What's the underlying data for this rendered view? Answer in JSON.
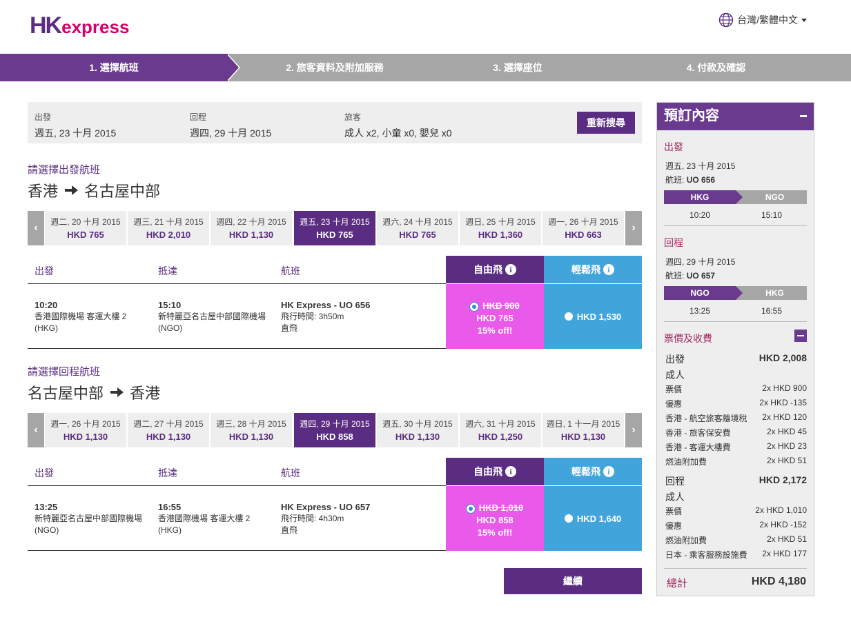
{
  "header": {
    "logo_hk": "HK",
    "logo_express": "express",
    "language": "台灣/繁體中文"
  },
  "steps": [
    {
      "label": "1. 選擇航班",
      "active": true
    },
    {
      "label": "2. 旅客資料及附加服務",
      "active": false
    },
    {
      "label": "3. 選擇座位",
      "active": false
    },
    {
      "label": "4. 付款及確認",
      "active": false
    }
  ],
  "summary": {
    "depart_label": "出發",
    "depart_value": "週五, 23 十月 2015",
    "return_label": "回程",
    "return_value": "週四, 29 十月 2015",
    "pax_label": "旅客",
    "pax_value": "成人 x2, 小童 x0, 嬰兒 x0",
    "research_button": "重新搜尋"
  },
  "outbound": {
    "subtitle": "請選擇出發航班",
    "from": "香港",
    "to": "名古屋中部",
    "dates": [
      {
        "date": "週二, 20 十月 2015",
        "price": "HKD 765"
      },
      {
        "date": "週三, 21 十月 2015",
        "price": "HKD 2,010"
      },
      {
        "date": "週四, 22 十月 2015",
        "price": "HKD 1,130"
      },
      {
        "date": "週五, 23 十月 2015",
        "price": "HKD 765",
        "selected": true
      },
      {
        "date": "週六, 24 十月 2015",
        "price": "HKD 765"
      },
      {
        "date": "週日, 25 十月 2015",
        "price": "HKD 1,360"
      },
      {
        "date": "週一, 26 十月 2015",
        "price": "HKD 663"
      }
    ],
    "table": {
      "col_depart": "出發",
      "col_arrive": "抵達",
      "col_flight": "航班",
      "fare_free": "自由飛",
      "fare_easy": "輕鬆飛",
      "depart_time": "10:20",
      "depart_airport": "香港國際機場 客運大樓 2",
      "depart_code": "(HKG)",
      "arrive_time": "15:10",
      "arrive_airport": "新特麗亞名古屋中部國際機場",
      "arrive_code": "(NGO)",
      "flight_name": "HK Express - UO 656",
      "flight_duration": "飛行時間: 3h50m",
      "flight_type": "直飛",
      "free_old_price": "HKD 900",
      "free_price": "HKD 765",
      "free_discount": "15% off!",
      "easy_price": "HKD 1,530"
    }
  },
  "inbound": {
    "subtitle": "請選擇回程航班",
    "from": "名古屋中部",
    "to": "香港",
    "dates": [
      {
        "date": "週一, 26 十月 2015",
        "price": "HKD 1,130"
      },
      {
        "date": "週二, 27 十月 2015",
        "price": "HKD 1,130"
      },
      {
        "date": "週三, 28 十月 2015",
        "price": "HKD 1,130"
      },
      {
        "date": "週四, 29 十月 2015",
        "price": "HKD 858",
        "selected": true
      },
      {
        "date": "週五, 30 十月 2015",
        "price": "HKD 1,130"
      },
      {
        "date": "週六, 31 十月 2015",
        "price": "HKD 1,250"
      },
      {
        "date": "週日, 1 十一月 2015",
        "price": "HKD 1,130"
      }
    ],
    "table": {
      "col_depart": "出發",
      "col_arrive": "抵達",
      "col_flight": "航班",
      "fare_free": "自由飛",
      "fare_easy": "輕鬆飛",
      "depart_time": "13:25",
      "depart_airport": "新特麗亞名古屋中部國際機場",
      "depart_code": "(NGO)",
      "arrive_time": "16:55",
      "arrive_airport": "香港國際機場 客運大樓 2",
      "arrive_code": "(HKG)",
      "flight_name": "HK Express - UO 657",
      "flight_duration": "飛行時間: 4h30m",
      "flight_type": "直飛",
      "free_old_price": "HKD 1,010",
      "free_price": "HKD 858",
      "free_discount": "15% off!",
      "easy_price": "HKD 1,640"
    }
  },
  "continue_button": "繼續",
  "panel": {
    "title": "預訂內容",
    "out_title": "出發",
    "out_date": "週五, 23 十月 2015",
    "out_flight_label": "航班:",
    "out_flight": "UO 656",
    "out_from": "HKG",
    "out_to": "NGO",
    "out_dep": "10:20",
    "out_arr": "15:10",
    "ret_title": "回程",
    "ret_date": "週四, 29 十月 2015",
    "ret_flight_label": "航班:",
    "ret_flight": "UO 657",
    "ret_from": "NGO",
    "ret_to": "HKG",
    "ret_dep": "13:25",
    "ret_arr": "16:55",
    "fees_title": "票價及收費",
    "out_fees_label": "出發",
    "out_fees_total": "HKD 2,008",
    "out_adult": "成人",
    "out_fees": [
      {
        "label": "票價",
        "value": "2x HKD 900"
      },
      {
        "label": "優惠",
        "value": "2x HKD -135"
      },
      {
        "label": "香港 - 航空旅客離境稅",
        "value": "2x HKD 120"
      },
      {
        "label": "香港 - 旅客保安費",
        "value": "2x HKD 45"
      },
      {
        "label": "香港 - 客運大樓費",
        "value": "2x HKD 23"
      },
      {
        "label": "燃油附加費",
        "value": "2x HKD 51"
      }
    ],
    "ret_fees_label": "回程",
    "ret_fees_total": "HKD 2,172",
    "ret_adult": "成人",
    "ret_fees": [
      {
        "label": "票價",
        "value": "2x HKD 1,010"
      },
      {
        "label": "優惠",
        "value": "2x HKD -152"
      },
      {
        "label": "燃油附加費",
        "value": "2x HKD 51"
      },
      {
        "label": "日本 - 乘客服務設施費",
        "value": "2x HKD 177"
      }
    ],
    "total_label": "總計",
    "total_value": "HKD 4,180"
  },
  "colors": {
    "brand_purple": "#5a2d82",
    "brand_magenta": "#d6006e",
    "free_fare": "#e959ea",
    "easy_fare": "#41a5dc"
  }
}
